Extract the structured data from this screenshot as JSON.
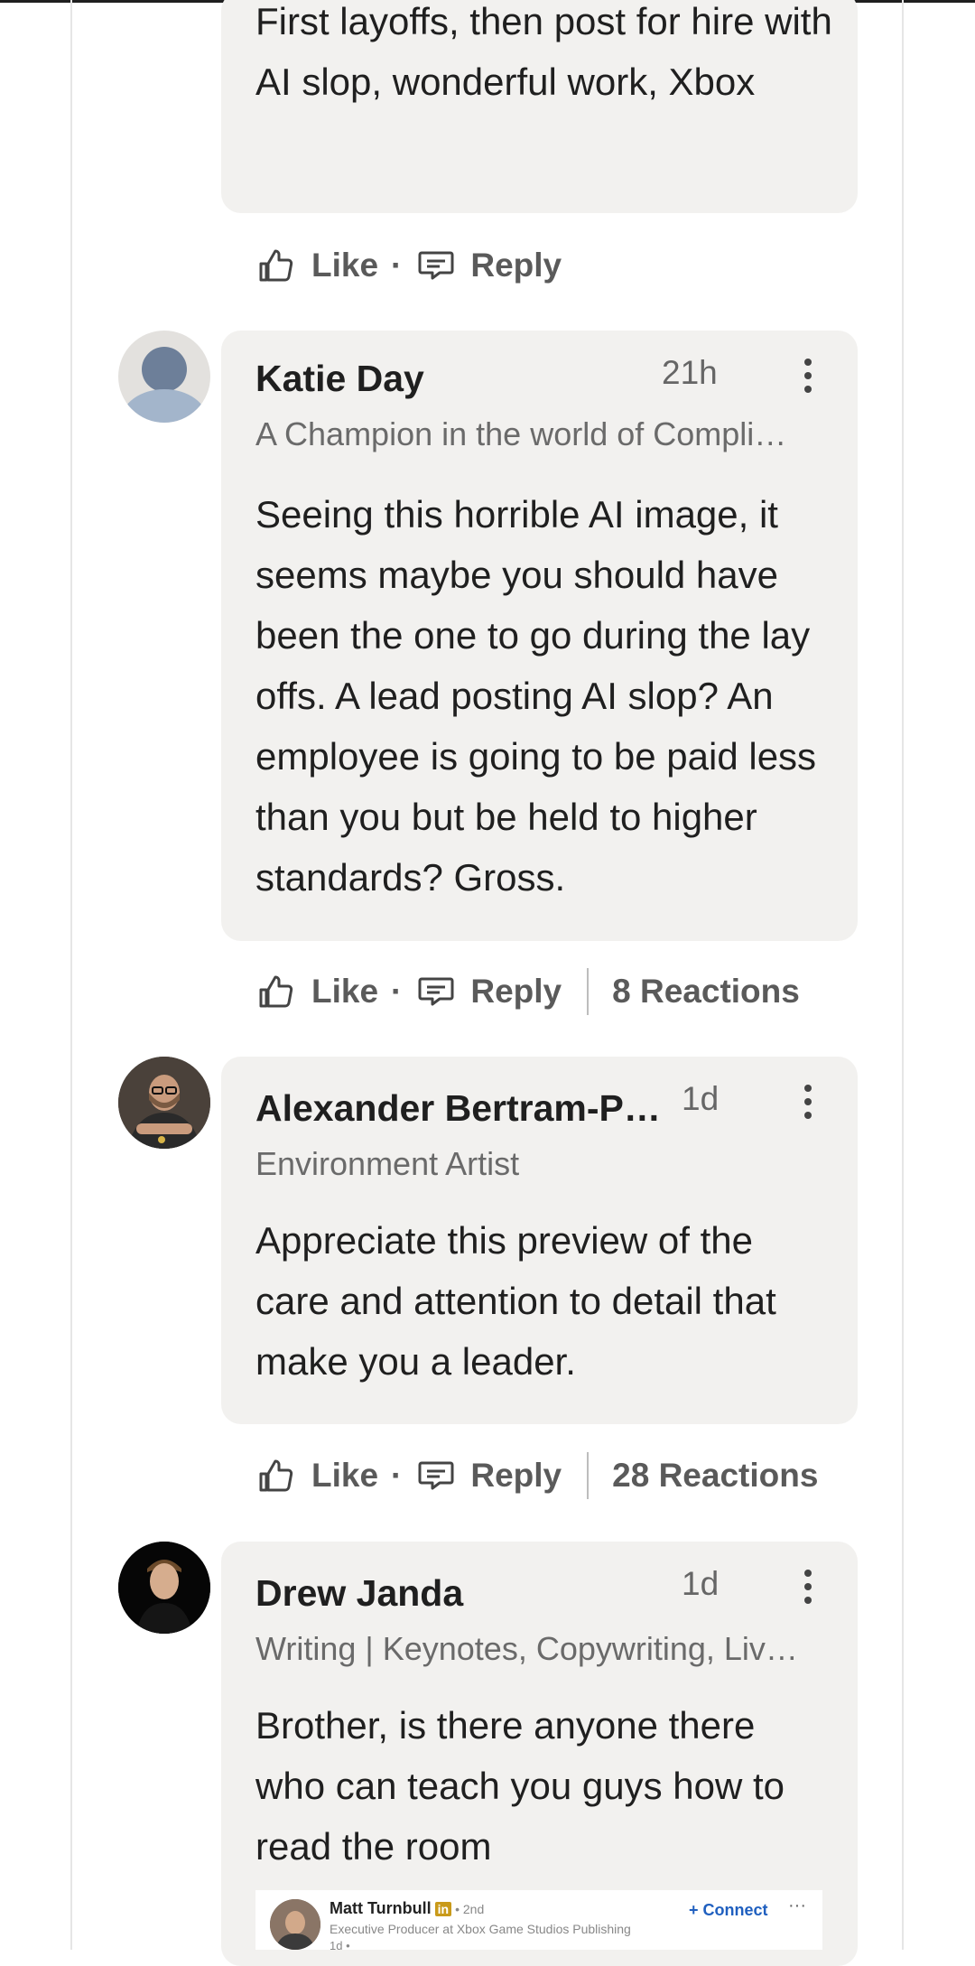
{
  "first_comment": {
    "text": "First layoffs, then post for hire with AI slop, wonderful work, Xbox",
    "like_label": "Like",
    "reply_label": "Reply"
  },
  "comments": [
    {
      "name": "Katie Day",
      "time": "21h",
      "headline": "A Champion in the world of Compli…",
      "text": "Seeing this horrible AI image, it seems maybe you should have been the one to go during the lay offs. A lead posting AI slop? An employee is going to be paid less than you but be held to higher standards? Gross.",
      "like_label": "Like",
      "reply_label": "Reply",
      "reactions": "8 Reactions"
    },
    {
      "name": "Alexander Bertram-P…",
      "time": "1d",
      "headline": "Environment Artist",
      "text": "Appreciate this preview of the care and attention to detail that make you a leader.",
      "like_label": "Like",
      "reply_label": "Reply",
      "reactions": "28 Reactions"
    },
    {
      "name": "Drew Janda",
      "time": "1d",
      "headline": "Writing | Keynotes, Copywriting, Liv…",
      "text": "Brother, is there anyone there who can teach you guys how to read the room"
    }
  ],
  "embedded_post": {
    "name": "Matt Turnbull",
    "badge": "in",
    "degree": "• 2nd",
    "subtitle": "Executive Producer at Xbox Game Studios Publishing",
    "time": "1d •",
    "connect_label": "Connect",
    "more": "···"
  },
  "colors": {
    "bubble": "#f2f1ef",
    "action_text": "#5a5a5a",
    "connect_blue": "#1f5fbf"
  },
  "icons": {
    "like": "thumbs-up-icon",
    "reply": "speech-bubble-icon",
    "menu": "more-vertical-icon"
  }
}
